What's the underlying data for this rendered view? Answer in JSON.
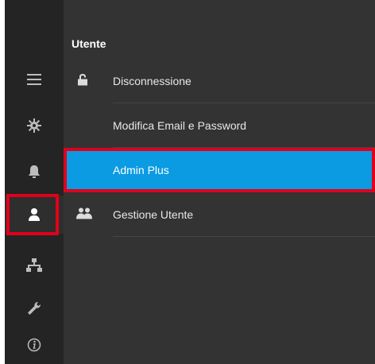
{
  "panel": {
    "title": "Utente",
    "items": [
      {
        "label": "Disconnessione",
        "icon": "lock-open-icon",
        "selected": false
      },
      {
        "label": "Modifica Email e Password",
        "icon": "",
        "selected": false
      },
      {
        "label": "Admin Plus",
        "icon": "",
        "selected": true
      },
      {
        "label": "Gestione Utente",
        "icon": "users-icon",
        "selected": false
      }
    ]
  },
  "rail": {
    "items": [
      {
        "icon": "menu-icon"
      },
      {
        "icon": "gear-icon"
      },
      {
        "icon": "bell-icon"
      },
      {
        "icon": "user-icon",
        "active": true
      },
      {
        "icon": "network-icon"
      },
      {
        "icon": "wrench-icon"
      },
      {
        "icon": "info-icon"
      }
    ]
  },
  "colors": {
    "selected": "#0a9be3",
    "highlight": "#e0001a",
    "panel": "#333333",
    "rail": "#242424"
  }
}
